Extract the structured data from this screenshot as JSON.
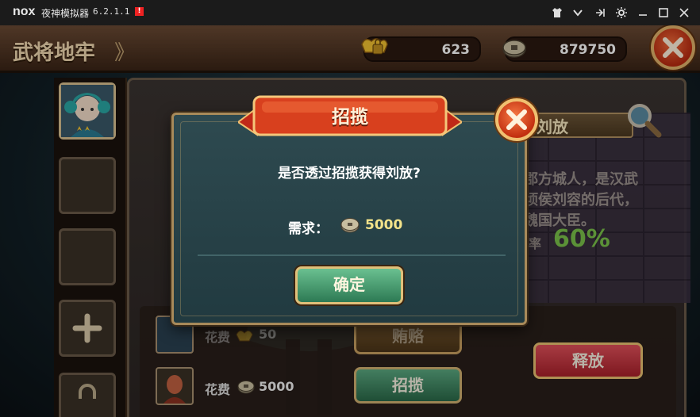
{
  "window": {
    "logo": "nox",
    "title": "夜神模拟器",
    "version": "6.2.1.1",
    "alert_badge": "!",
    "controls": [
      "shirt-icon",
      "chevron-down-icon",
      "pin-icon",
      "settings-icon",
      "minimize-icon",
      "maximize-icon",
      "close-icon"
    ]
  },
  "header": {
    "title": "武将地牢",
    "arrows": "》",
    "gold": "623",
    "coins": "879750"
  },
  "hero": {
    "name": "刘放",
    "description": "字子弃，涿郡方城人，是汉武帝曾孙西乡顷侯刘容的后代，三国时代为魏国大臣。",
    "rate_label": "招揽机率",
    "rate_value": "60%"
  },
  "costs": [
    {
      "label": "花费",
      "amount": "50",
      "button": "贿赂"
    },
    {
      "label": "花费",
      "amount": "5000",
      "button": "招揽"
    }
  ],
  "release_button": "释放",
  "dialog": {
    "title": "招揽",
    "question": "是否透过招揽获得刘放?",
    "need_label": "需求：",
    "need_value": "5000",
    "confirm": "确定"
  },
  "colors": {
    "accent_gold": "#e0c07a",
    "rate_green": "#7ac24a",
    "need_yellow": "#f3e38a",
    "close_red": "#c23010"
  }
}
